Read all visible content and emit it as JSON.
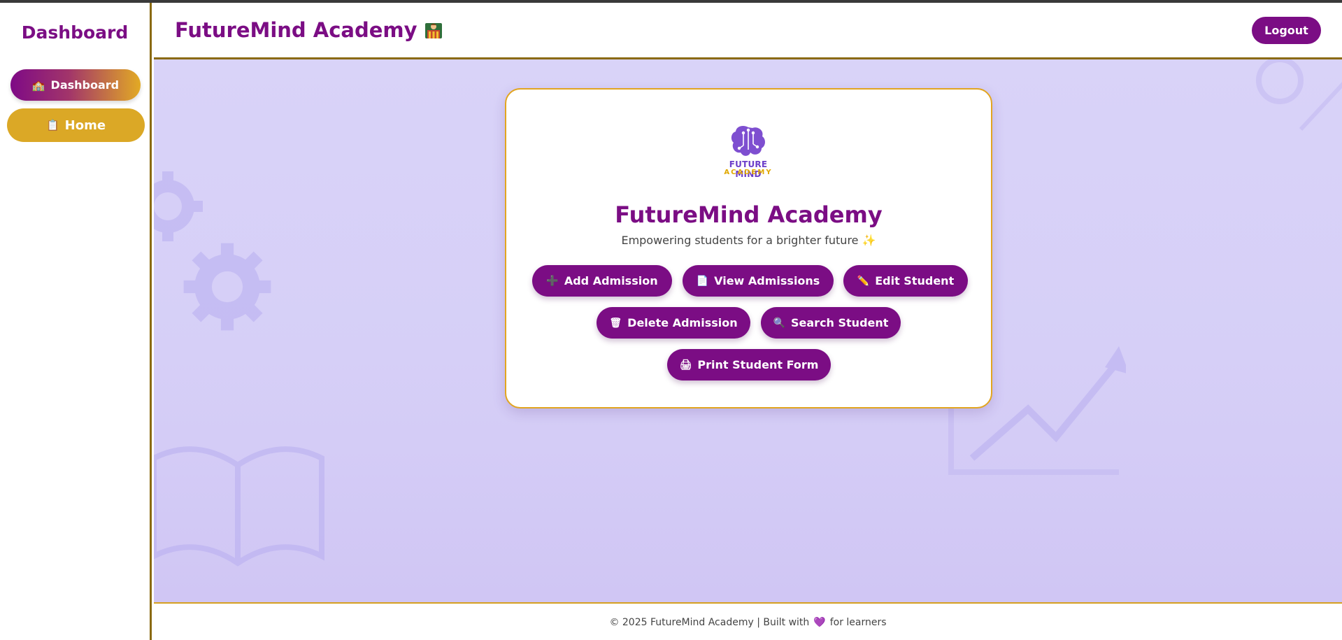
{
  "sidebar": {
    "title": "Dashboard",
    "items": [
      {
        "icon": "🏫",
        "icon_name": "school-icon",
        "label": "Dashboard"
      },
      {
        "icon": "📋",
        "icon_name": "clipboard-icon",
        "label": "Home"
      }
    ]
  },
  "header": {
    "title": "FutureMind Academy",
    "title_icon_name": "school-flag-icon",
    "logout_label": "Logout"
  },
  "card": {
    "logo_line1": "FUTURE MIND",
    "logo_line2": "ACADEMY",
    "title": "FutureMind Academy",
    "subtitle": "Empowering students for a brighter future",
    "subtitle_icon": "✨",
    "actions": [
      {
        "icon": "➕",
        "icon_name": "plus-icon",
        "label": "Add Admission"
      },
      {
        "icon": "📄",
        "icon_name": "document-icon",
        "label": "View Admissions"
      },
      {
        "icon": "✏️",
        "icon_name": "pencil-icon",
        "label": "Edit Student"
      },
      {
        "icon": "🗑",
        "icon_name": "trash-icon",
        "label": "Delete Admission"
      },
      {
        "icon": "🔍",
        "icon_name": "magnifier-icon",
        "label": "Search Student"
      },
      {
        "icon": "🖨",
        "icon_name": "printer-icon",
        "label": "Print Student Form"
      }
    ]
  },
  "footer": {
    "text_before": "© 2025 FutureMind Academy | Built with",
    "heart": "💜",
    "text_after": "for learners"
  },
  "colors": {
    "brand_purple": "#7b0d84",
    "accent_gold": "#dba826",
    "background_lavender": "#d6cff7"
  }
}
